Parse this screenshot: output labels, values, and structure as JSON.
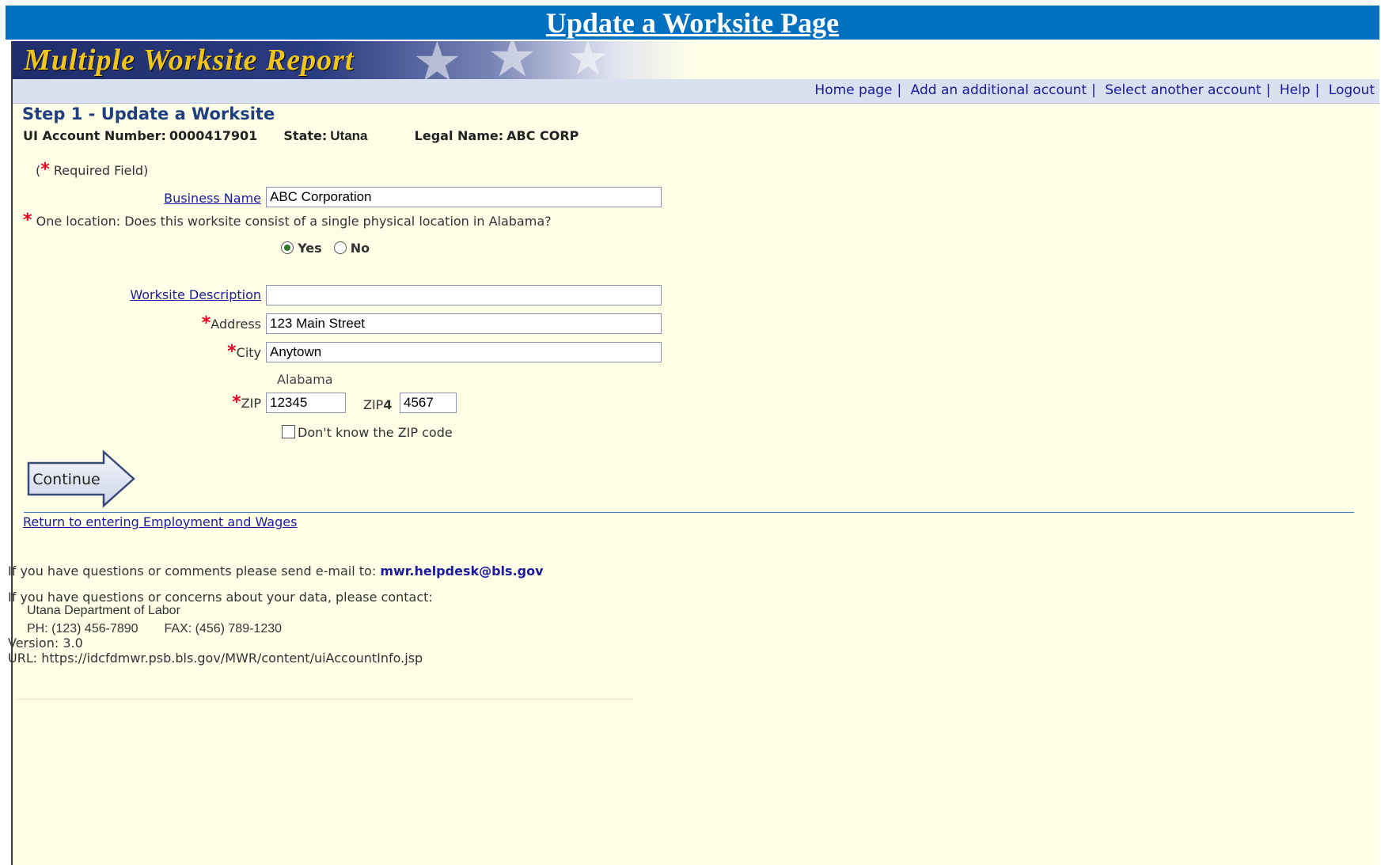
{
  "page_title": "Update a Worksite Page",
  "app": {
    "brand": "Multiple Worksite Report"
  },
  "nav": {
    "items": [
      {
        "label": "Home page"
      },
      {
        "label": "Add an additional account"
      },
      {
        "label": "Select another account"
      },
      {
        "label": "Help"
      },
      {
        "label": "Logout"
      }
    ],
    "separator": "|"
  },
  "step_title": "Step 1 - Update a Worksite",
  "account": {
    "ui_label": "UI Account Number:",
    "ui_value": "0000417901",
    "state_label": "State:",
    "state_value": "Utana",
    "legal_label": "Legal Name:",
    "legal_value": "ABC CORP"
  },
  "required_note": {
    "open": "(",
    "text": " Required Field)",
    "star": "*"
  },
  "form": {
    "business_name": {
      "label": "Business Name",
      "value": "ABC Corporation"
    },
    "one_location_question": "One location: Does this worksite consist of a single physical location in Alabama?",
    "radio_yes": "Yes",
    "radio_no": "No",
    "selected": "Yes",
    "worksite_description": {
      "label": "Worksite Description",
      "value": ""
    },
    "address": {
      "label": "Address",
      "value": "123 Main Street"
    },
    "city": {
      "label": "City",
      "value": "Anytown"
    },
    "state": "Alabama",
    "zip": {
      "label": "ZIP",
      "value": "12345"
    },
    "zip4": {
      "label_a": "ZIP",
      "label_b": "4",
      "value": "4567"
    },
    "dont_know_zip": "Don't know the ZIP code"
  },
  "continue_label": "Continue",
  "return_link": "Return to entering Employment and Wages",
  "footer": {
    "email_prompt": "If you have questions or comments please send e-mail to:",
    "email": "mwr.helpdesk@bls.gov",
    "contact_prompt": "If you have questions or concerns about your data, please contact:",
    "dept": "Utana  Department of  Labor",
    "phone_label": "PH:",
    "phone": "(123) 456-7890",
    "fax_label": "FAX:",
    "fax": "(456) 789-1230",
    "version": "Version: 3.0",
    "url": "URL: https://idcfdmwr.psb.bls.gov/MWR/content/uiAccountInfo.jsp"
  },
  "colors": {
    "title_bar": "#0070c0",
    "background": "#ffffe8",
    "link": "#1a1a9e",
    "required_star": "#e8001c",
    "brand_text": "#f0c419"
  }
}
